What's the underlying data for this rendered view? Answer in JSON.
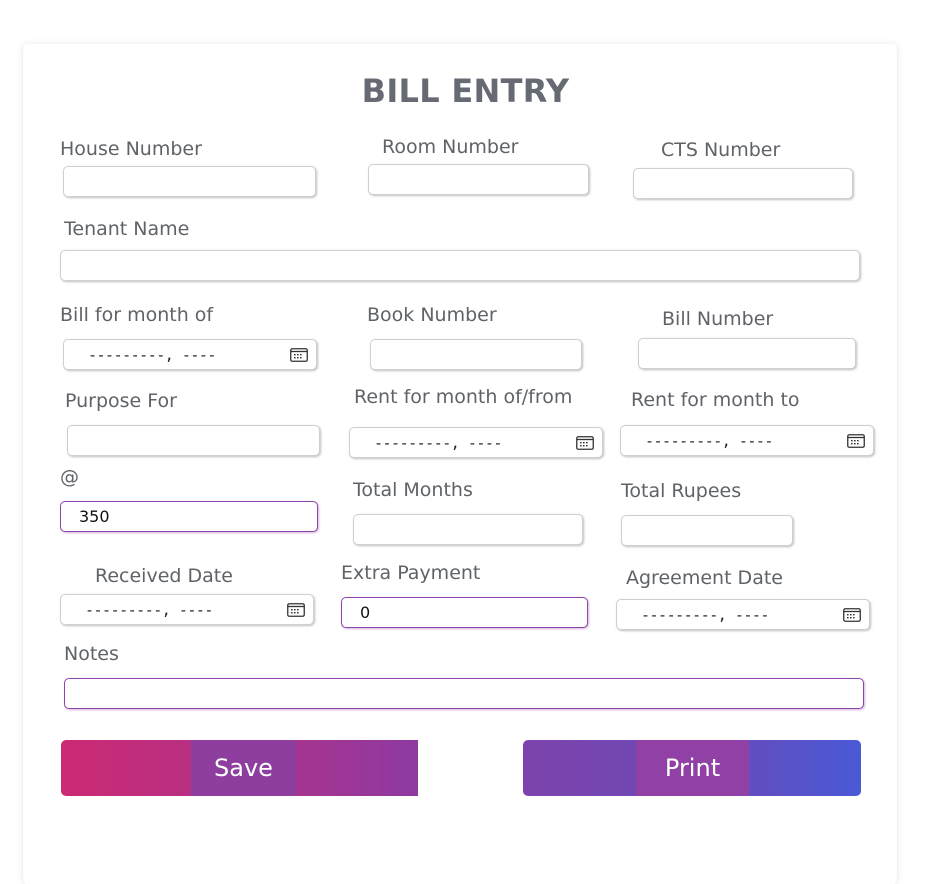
{
  "form": {
    "title": "BILL ENTRY",
    "labels": {
      "house_number": "House Number",
      "room_number": "Room Number",
      "cts_number": "CTS Number",
      "tenant_name": "Tenant Name",
      "bill_for_month": "Bill for month of",
      "book_number": "Book Number",
      "bill_number": "Bill Number",
      "purpose_for": "Purpose For",
      "rent_from": "Rent for month of/from",
      "rent_to": "Rent for month to",
      "rate": "@",
      "total_months": "Total Months",
      "total_rupees": "Total Rupees",
      "received_date": "Received Date",
      "extra_payment": "Extra Payment",
      "agreement_date": "Agreement Date",
      "notes": "Notes"
    },
    "values": {
      "house_number": "",
      "room_number": "",
      "cts_number": "",
      "tenant_name": "",
      "book_number": "",
      "bill_number": "",
      "purpose_for": "",
      "rate": "350",
      "total_months": "",
      "total_rupees": "",
      "extra_payment": "0",
      "notes": ""
    },
    "month_placeholder": "---------, ----",
    "buttons": {
      "save": "Save",
      "print": "Print"
    }
  },
  "icons": {
    "calendar": "calendar-icon"
  },
  "colors": {
    "active_border": "#8e44ad",
    "save_gradient_start": "#cc2a74",
    "print_gradient_end": "#4a59d6",
    "title": "#666a73"
  }
}
